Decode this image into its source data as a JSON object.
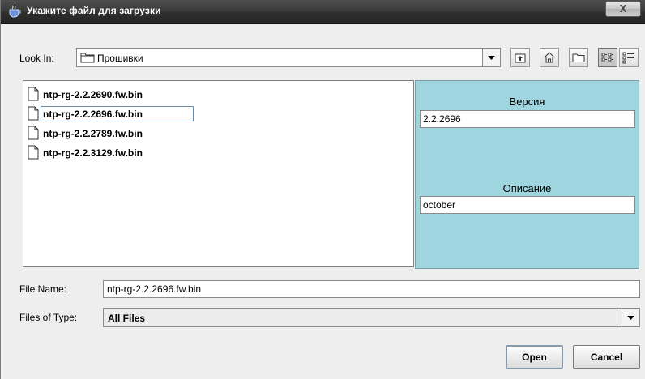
{
  "window": {
    "title": "Укажите файл для загрузки",
    "close_label": "X"
  },
  "lookin": {
    "label": "Look In:",
    "value": "Прошивки"
  },
  "toolbar": {
    "icons": [
      "up-one-level-icon",
      "home-icon",
      "new-folder-icon",
      "list-view-icon",
      "details-view-icon"
    ]
  },
  "files": [
    {
      "name": "ntp-rg-2.2.2690.fw.bin",
      "selected": false
    },
    {
      "name": "ntp-rg-2.2.2696.fw.bin",
      "selected": true
    },
    {
      "name": "ntp-rg-2.2.2789.fw.bin",
      "selected": false
    },
    {
      "name": "ntp-rg-2.2.3129.fw.bin",
      "selected": false
    }
  ],
  "accessory": {
    "version_label": "Версия",
    "version_value": "2.2.2696",
    "description_label": "Описание",
    "description_value": "october"
  },
  "filename": {
    "label": "File Name:",
    "value": "ntp-rg-2.2.2696.fw.bin"
  },
  "filetype": {
    "label": "Files of Type:",
    "value": "All Files"
  },
  "buttons": {
    "open": "Open",
    "cancel": "Cancel"
  },
  "colors": {
    "accessory_bg": "#9ed5de",
    "title_bg": "#3b3b3b"
  }
}
